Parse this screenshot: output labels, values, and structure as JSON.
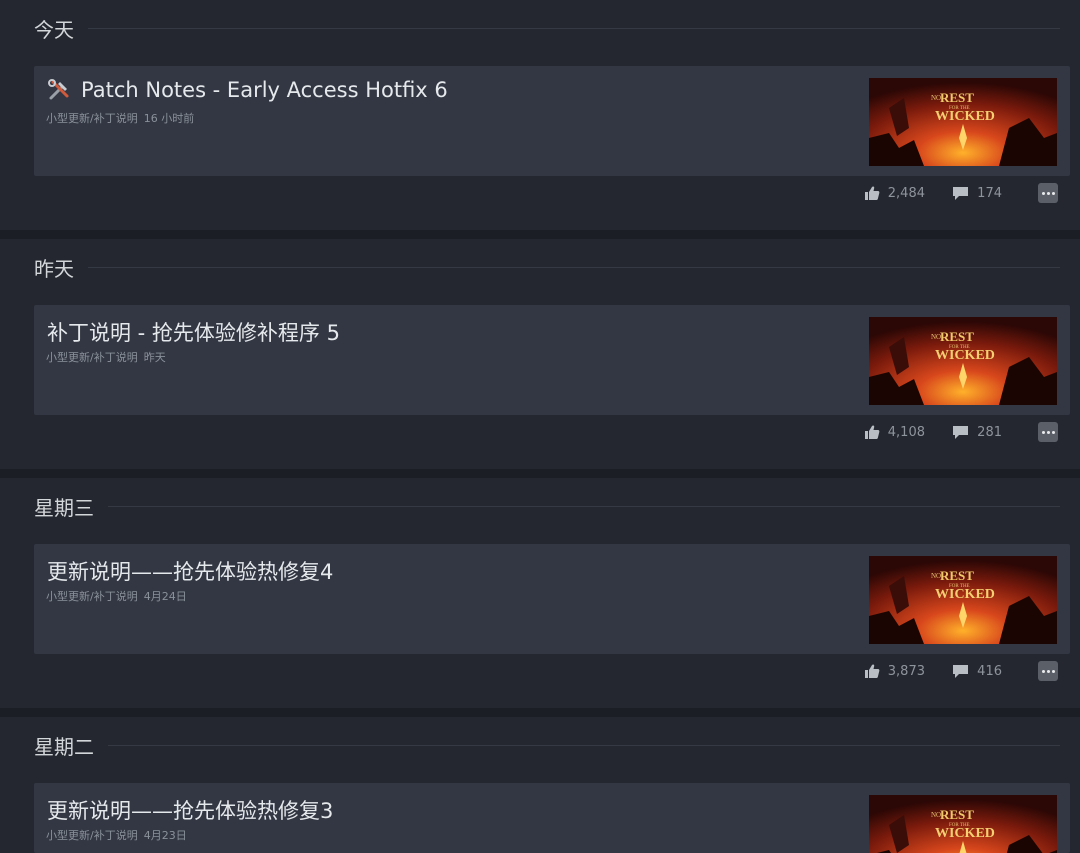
{
  "sections": [
    {
      "day": "今天",
      "post": {
        "title": "Patch Notes - Early Access Hotfix 6",
        "has_icon": true,
        "category": "小型更新/补丁说明",
        "time": "16 小时前",
        "likes": "2,484",
        "comments": "174"
      }
    },
    {
      "day": "昨天",
      "post": {
        "title": "补丁说明 - 抢先体验修补程序 5",
        "has_icon": false,
        "category": "小型更新/补丁说明",
        "time": "昨天",
        "likes": "4,108",
        "comments": "281"
      }
    },
    {
      "day": "星期三",
      "post": {
        "title": "更新说明——抢先体验热修复4",
        "has_icon": false,
        "category": "小型更新/补丁说明",
        "time": "4月24日",
        "likes": "3,873",
        "comments": "416"
      }
    },
    {
      "day": "星期二",
      "post": {
        "title": "更新说明——抢先体验热修复3",
        "has_icon": false,
        "category": "小型更新/补丁说明",
        "time": "4月23日"
      }
    }
  ],
  "thumbnail": {
    "title_lines": [
      "NO",
      "REST",
      "FOR THE",
      "WICKED"
    ]
  },
  "icons": {
    "title_icon": "tools-icon",
    "like": "thumbs-up-icon",
    "comment": "comment-icon",
    "more": "more-options-icon"
  },
  "colors": {
    "background": "#1b1e25",
    "section": "#24272f",
    "card": "#323743",
    "muted_text": "#8b919a"
  }
}
